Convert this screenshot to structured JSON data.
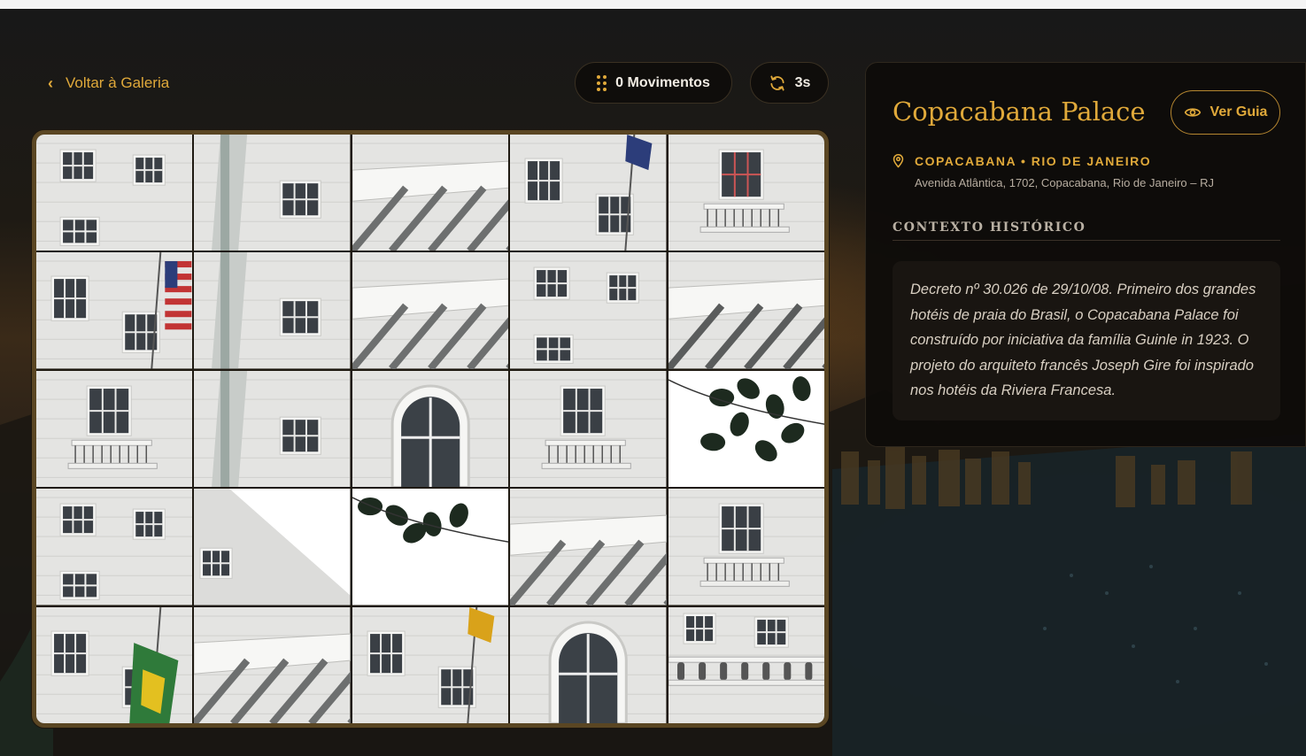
{
  "header": {
    "back_label": "Voltar à Galeria",
    "moves_label": "0 Movimentos",
    "timer_label": "3s"
  },
  "puzzle": {
    "rows": 5,
    "columns": 5,
    "moves": 0,
    "elapsed_seconds": 3
  },
  "place": {
    "title": "Copacabana Palace",
    "guide_label": "Ver Guia",
    "location": "COPACABANA • RIO DE JANEIRO",
    "address": "Avenida Atlântica, 1702, Copacabana, Rio de Janeiro – RJ",
    "context_heading": "CONTEXTO HISTÓRICO",
    "context_text": "Decreto nº 30.026 de 29/10/08. Primeiro dos grandes hotéis de praia do Brasil, o Copacabana Palace foi construído por iniciativa da família Guinle in 1923. O projeto do arquiteto francês Joseph Gire foi inspirado nos hotéis da Riviera Francesa."
  },
  "icons": {
    "back": "chevron-left-icon",
    "moves": "grid-dots-icon",
    "timer": "refresh-icon",
    "guide": "eye-icon",
    "location": "map-pin-icon"
  },
  "colors": {
    "accent": "#e0a93a",
    "panel": "#0e0c0a",
    "board_border": "#5a4623"
  }
}
